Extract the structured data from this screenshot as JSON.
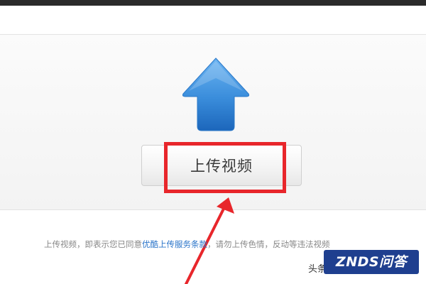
{
  "upload": {
    "button_label": "上传视频",
    "icon": "up-arrow-icon"
  },
  "agreement": {
    "prefix": "上传视频，即表示您已同意",
    "link": "优酷上传服务条款",
    "suffix": "，请勿上传色情，反动等违法视频"
  },
  "watermark": {
    "source": "头条",
    "logo_text": "ZNDS问答"
  },
  "colors": {
    "highlight": "#e8262b",
    "link": "#2a74c9",
    "icon_top": "#5aa7ee",
    "icon_bottom": "#1e6fc4",
    "watermark_bg": "#1f3f8f"
  }
}
